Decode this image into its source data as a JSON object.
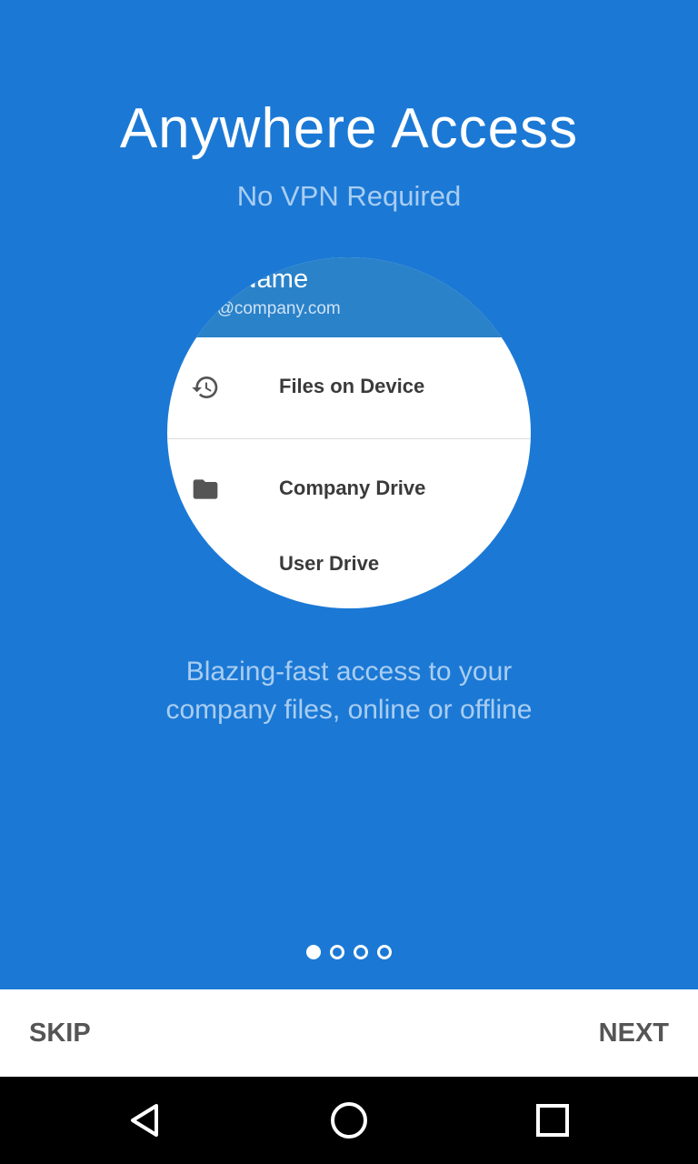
{
  "onboarding": {
    "title": "Anywhere Access",
    "subtitle": "No VPN Required",
    "description_line1": "Blazing-fast access to your",
    "description_line2": "company files, online or offline",
    "page_index": 1,
    "page_count": 4
  },
  "preview": {
    "user_name_partial": "· Name",
    "user_email_partial": "u@company.com",
    "menu": [
      {
        "label": "Files on Device",
        "icon": "history-icon"
      },
      {
        "label": "Company Drive",
        "icon": "folder-icon"
      },
      {
        "label": "User Drive",
        "icon": ""
      }
    ]
  },
  "footer": {
    "skip_label": "SKIP",
    "next_label": "NEXT"
  },
  "navigation": {
    "back": "back-icon",
    "home": "home-icon",
    "recents": "recents-icon"
  },
  "colors": {
    "background": "#1b79d5",
    "header": "#2a82c9",
    "muted_text": "#a9cdf2"
  }
}
